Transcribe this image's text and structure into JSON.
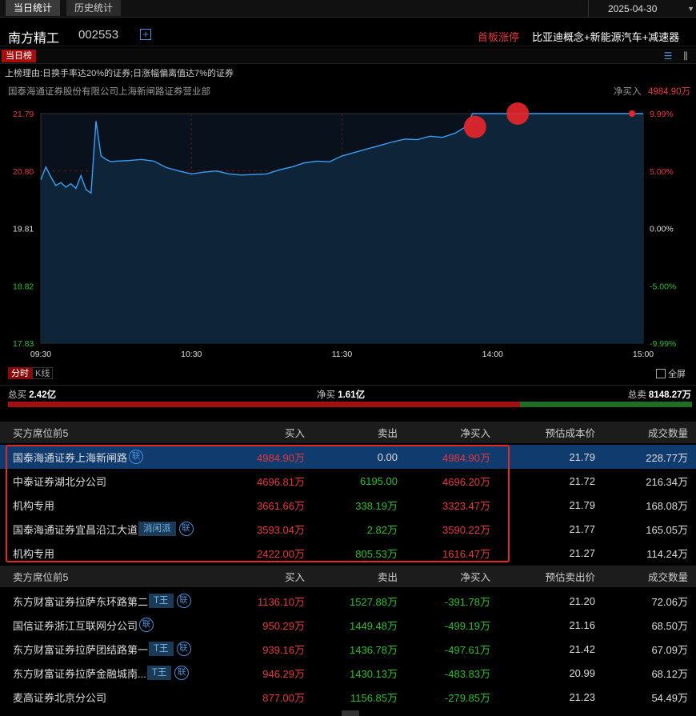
{
  "tabs": [
    {
      "label": "当日统计"
    },
    {
      "label": "历史统计"
    }
  ],
  "date": "2025-04-30",
  "stock": {
    "name": "南方精工",
    "code": "002553",
    "limit_tag": "首板涨停",
    "concept": "比亚迪概念+新能源汽车+减速器"
  },
  "list_tag": "当日榜",
  "reason": "上榜理由:日换手率达20%的证券;日涨幅偏离值达7%的证券",
  "broker_title": "国泰海通证券股份有限公司上海新闸路证券营业部",
  "net_buy_label": "净买入",
  "net_buy_value": "4984.90万",
  "chart_data": {
    "type": "line",
    "y_left_ticks": [
      "21.79",
      "20.80",
      "19.81",
      "18.82",
      "17.83"
    ],
    "y_right_ticks": [
      "9.99%",
      "5.00%",
      "0.00%",
      "-5.00%",
      "-9.99%"
    ],
    "x_ticks": [
      "09:30",
      "10:30",
      "11:30",
      "14:00",
      "15:00"
    ],
    "ylim": [
      17.83,
      21.79
    ],
    "prev_close": 19.81,
    "times_min": [
      0,
      2,
      4,
      6,
      8,
      10,
      12,
      14,
      16,
      18,
      20,
      22,
      24,
      26,
      28,
      30,
      35,
      40,
      45,
      50,
      55,
      60,
      65,
      70,
      75,
      80,
      85,
      90,
      95,
      100,
      105,
      110,
      115,
      120,
      125,
      130,
      135,
      140,
      145,
      150,
      155,
      160,
      165,
      170,
      172,
      175,
      178,
      180,
      185,
      190,
      195,
      200,
      205,
      210,
      215,
      220,
      225,
      230,
      235,
      240
    ],
    "prices": [
      20.65,
      20.87,
      20.7,
      20.55,
      20.6,
      20.52,
      20.58,
      20.5,
      20.72,
      20.48,
      20.42,
      21.66,
      21.06,
      21.0,
      20.96,
      20.97,
      20.98,
      21.0,
      20.97,
      20.86,
      20.8,
      20.75,
      20.78,
      20.8,
      20.75,
      20.73,
      20.74,
      20.75,
      20.82,
      20.87,
      20.94,
      20.97,
      20.96,
      21.06,
      21.12,
      21.18,
      21.24,
      21.3,
      21.35,
      21.34,
      21.4,
      21.38,
      21.45,
      21.58,
      21.79,
      21.79,
      21.79,
      21.79,
      21.79,
      21.79,
      21.79,
      21.79,
      21.79,
      21.79,
      21.79,
      21.79,
      21.79,
      21.79,
      21.79,
      21.79
    ],
    "markers": [
      {
        "t": 173,
        "price": 21.56
      },
      {
        "t": 190,
        "price": 21.79
      }
    ]
  },
  "chart_tabs": [
    {
      "label": "分时"
    },
    {
      "label": "K线"
    }
  ],
  "fullscreen": "全屏",
  "summary": {
    "total_buy_label": "总买",
    "total_buy": "2.42亿",
    "net_label": "净买",
    "net": "1.61亿",
    "total_sell_label": "总卖",
    "total_sell": "8148.27万",
    "buy_ratio": 0.748
  },
  "buy_table": {
    "headers": [
      "买方席位前5",
      "买入",
      "卖出",
      "净买入",
      "预估成本价",
      "成交数量"
    ],
    "rows": [
      {
        "name": "国泰海通证券上海新闸路",
        "tag": "",
        "link": "联",
        "buy": "4984.90万",
        "sell": "0.00",
        "net": "4984.90万",
        "cost": "21.79",
        "vol": "228.77万"
      },
      {
        "name": "中泰证券湖北分公司",
        "tag": "",
        "link": "",
        "buy": "4696.81万",
        "sell": "6195.00",
        "net": "4696.20万",
        "cost": "21.72",
        "vol": "216.34万"
      },
      {
        "name": "机构专用",
        "tag": "",
        "link": "",
        "buy": "3661.66万",
        "sell": "338.19万",
        "net": "3323.47万",
        "cost": "21.79",
        "vol": "168.08万"
      },
      {
        "name": "国泰海通证券宜昌沿江大道",
        "tag": "消闲派",
        "link": "联",
        "buy": "3593.04万",
        "sell": "2.82万",
        "net": "3590.22万",
        "cost": "21.77",
        "vol": "165.05万"
      },
      {
        "name": "机构专用",
        "tag": "",
        "link": "",
        "buy": "2422.00万",
        "sell": "805.53万",
        "net": "1616.47万",
        "cost": "21.27",
        "vol": "114.24万"
      }
    ]
  },
  "sell_table": {
    "headers": [
      "卖方席位前5",
      "买入",
      "卖出",
      "净买入",
      "预估卖出价",
      "成交数量"
    ],
    "rows": [
      {
        "name": "东方财富证券拉萨东环路第二",
        "tag": "T王",
        "link": "联",
        "buy": "1136.10万",
        "sell": "1527.88万",
        "net": "-391.78万",
        "cost": "21.20",
        "vol": "72.06万"
      },
      {
        "name": "国信证券浙江互联网分公司",
        "tag": "",
        "link": "联",
        "buy": "950.29万",
        "sell": "1449.48万",
        "net": "-499.19万",
        "cost": "21.16",
        "vol": "68.50万"
      },
      {
        "name": "东方财富证券拉萨团结路第一",
        "tag": "T王",
        "link": "联",
        "buy": "939.16万",
        "sell": "1436.78万",
        "net": "-497.61万",
        "cost": "21.42",
        "vol": "67.09万"
      },
      {
        "name": "东方财富证券拉萨金融城南...",
        "tag": "T王",
        "link": "联",
        "buy": "946.29万",
        "sell": "1430.13万",
        "net": "-483.83万",
        "cost": "20.99",
        "vol": "68.12万"
      },
      {
        "name": "麦高证券北京分公司",
        "tag": "",
        "link": "",
        "buy": "877.00万",
        "sell": "1156.85万",
        "net": "-279.85万",
        "cost": "21.23",
        "vol": "54.49万"
      }
    ]
  }
}
